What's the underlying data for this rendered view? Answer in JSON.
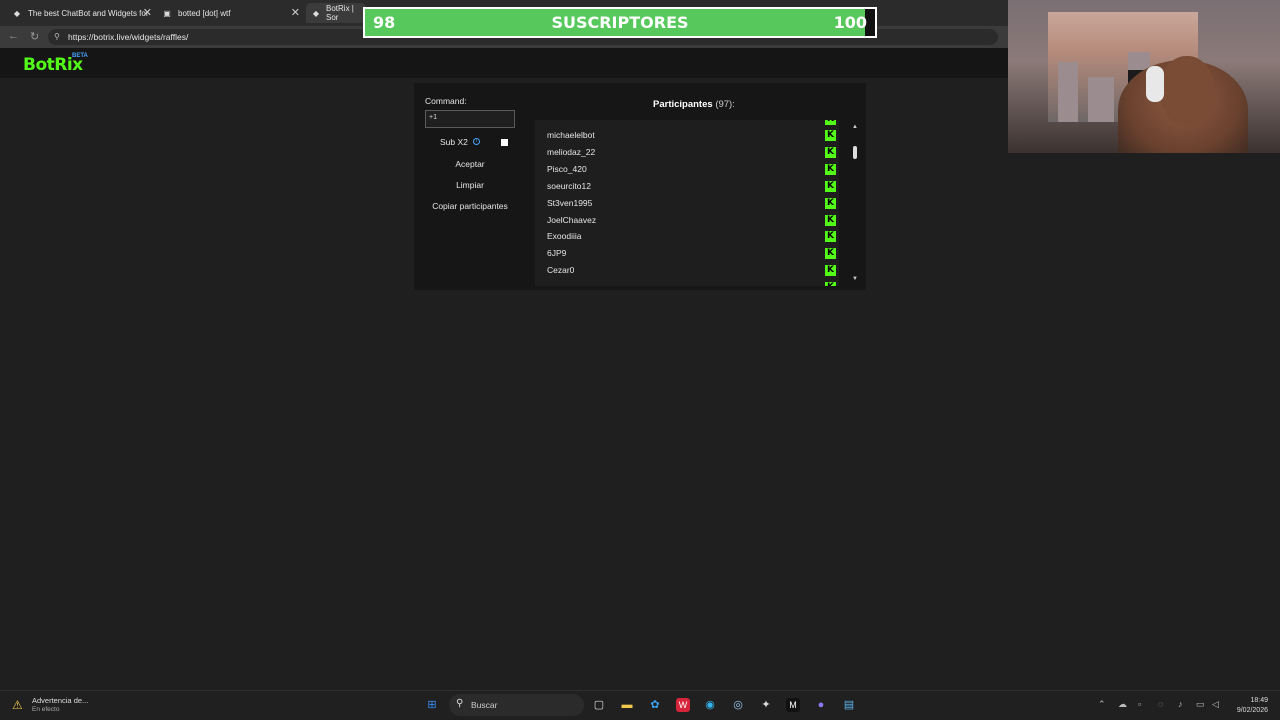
{
  "browser": {
    "tabs": [
      {
        "title": "The best ChatBot and Widgets for",
        "icon": "botrix-icon"
      },
      {
        "title": "botted [dot] wtf",
        "icon": "site-icon"
      },
      {
        "title": "BotRix | Sor",
        "icon": "botrix-icon"
      }
    ],
    "url": "https://botrix.live/widgets/raffles/"
  },
  "overlay": {
    "current": "98",
    "label": "SUSCRIPTORES",
    "goal": "100",
    "progress_fraction": 0.98,
    "fill_color": "#57c85b"
  },
  "app": {
    "logo": "BotRix",
    "beta": "BETA",
    "command_label": "Command:",
    "command_value": "+1",
    "sub_label": "Sub X2",
    "sub_checked": false,
    "accept_label": "Aceptar",
    "clear_label": "Limpiar",
    "copy_label": "Copiar participantes",
    "participants_title": "Participantes",
    "participants_count": "(97):",
    "participants": [
      "michaelelbot",
      "meliodaz_22",
      "Pisco_420",
      "soeurcito12",
      "St3ven1995",
      "JoelChaavez",
      "Exoodiiia",
      "6JP9",
      "Cezar0"
    ],
    "platform_icon": "kick-icon",
    "accent_color": "#53fc18"
  },
  "taskbar": {
    "notification_title": "Advertencia de...",
    "notification_sub": "En efecto",
    "search_placeholder": "Buscar",
    "time": "18:49",
    "date": "9/02/2026"
  }
}
